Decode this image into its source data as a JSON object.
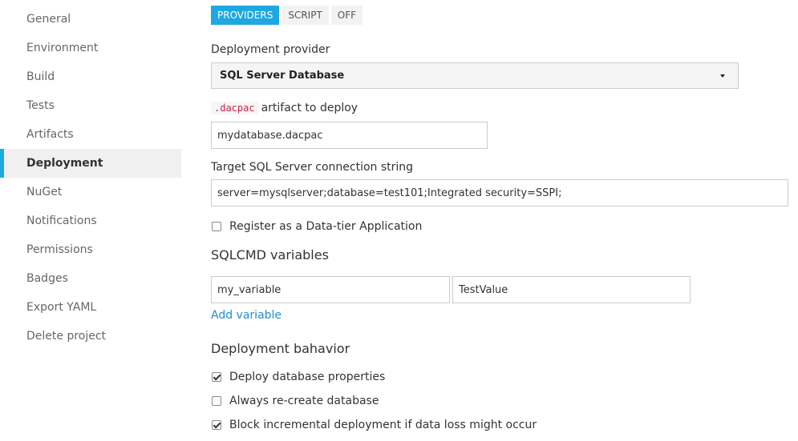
{
  "sidebar": {
    "items": [
      {
        "label": "General"
      },
      {
        "label": "Environment"
      },
      {
        "label": "Build"
      },
      {
        "label": "Tests"
      },
      {
        "label": "Artifacts"
      },
      {
        "label": "Deployment"
      },
      {
        "label": "NuGet"
      },
      {
        "label": "Notifications"
      },
      {
        "label": "Permissions"
      },
      {
        "label": "Badges"
      },
      {
        "label": "Export YAML"
      },
      {
        "label": "Delete project"
      }
    ],
    "active": "Deployment"
  },
  "tabs": [
    {
      "label": "PROVIDERS",
      "active": true
    },
    {
      "label": "SCRIPT",
      "active": false
    },
    {
      "label": "OFF",
      "active": false
    }
  ],
  "provider": {
    "label": "Deployment provider",
    "selected": "SQL Server Database"
  },
  "artifact": {
    "code": ".dacpac",
    "label_rest": "artifact to deploy",
    "value": "mydatabase.dacpac"
  },
  "connection": {
    "label": "Target SQL Server connection string",
    "value": "server=mysqlserver;database=test101;Integrated security=SSPI;"
  },
  "register_dac": {
    "label": "Register as a Data-tier Application",
    "checked": false
  },
  "sqlcmd": {
    "title": "SQLCMD variables",
    "name_value": "my_variable",
    "value_value": "TestValue",
    "add_label": "Add variable"
  },
  "behavior": {
    "title": "Deployment bahavior",
    "options": [
      {
        "label": "Deploy database properties",
        "checked": true
      },
      {
        "label": "Always re-create database",
        "checked": false
      },
      {
        "label": "Block incremental deployment if data loss might occur",
        "checked": true
      }
    ]
  },
  "colors": {
    "accent": "#1fa8e0",
    "link": "#1f8ed0",
    "code_text": "#c7254e"
  }
}
